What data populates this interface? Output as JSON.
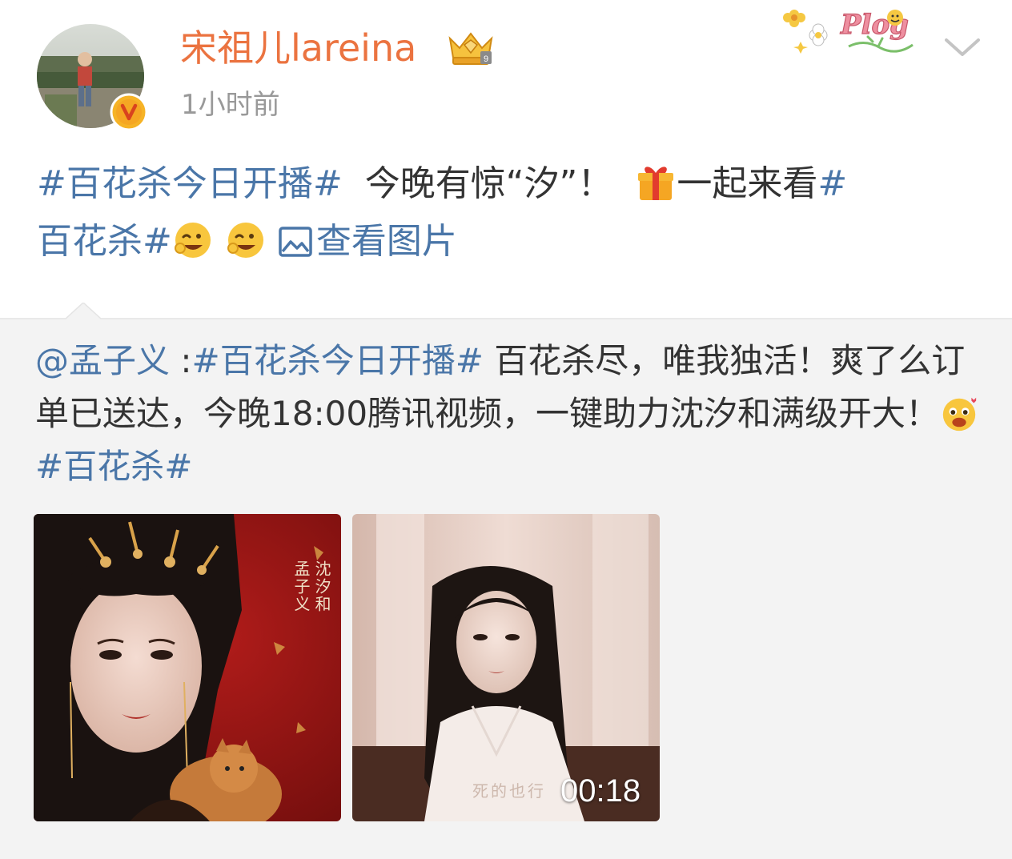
{
  "author": {
    "name": "宋祖儿lareina",
    "timestamp": "1小时前",
    "badge_icon": "crown-vip-icon",
    "verified_icon": "verified-v-icon",
    "sticker_text": "Plog"
  },
  "post": {
    "tag1": "#百花杀今日开播#",
    "text1": "今晚有惊“汐”！",
    "text2": "一起来看",
    "tag2_part1": "#",
    "tag2_part2": "百花杀#",
    "view_images": "查看图片"
  },
  "repost": {
    "mention": "@孟子义",
    "sep": " :",
    "tag1": "#百花杀今日开播#",
    "text1": " 百花杀尽，唯我独活！爽了么订单已送达，今晚18:00腾讯视频，一键助力沈汐和满级开大！",
    "tag2": "#百花杀#"
  },
  "media": {
    "image1": {
      "name_text": "孟子义",
      "role_text": "沈汐和"
    },
    "image2": {
      "caption": "死的也行",
      "duration": "00:18"
    }
  },
  "colors": {
    "link": "#4a76a8",
    "username": "#eb7340",
    "repost_bg": "#f3f3f3"
  }
}
